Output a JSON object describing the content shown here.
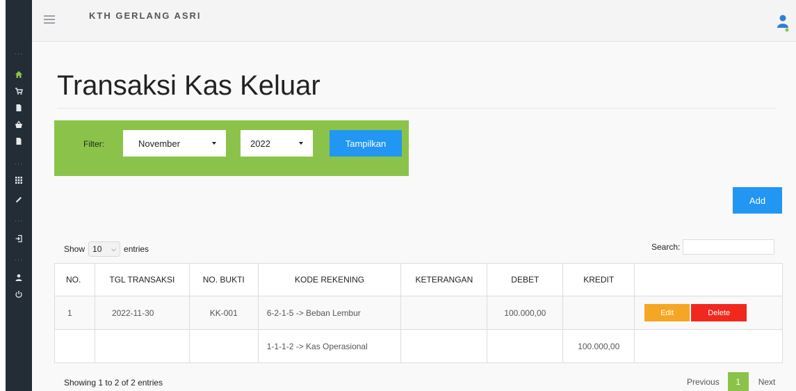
{
  "brand": "KTH GERLANG ASRI",
  "page_title": "Transaksi Kas Keluar",
  "filter": {
    "label": "Filter:",
    "month": "November",
    "year": "2022",
    "submit_label": "Tampilkan"
  },
  "add_label": "Add",
  "table_controls": {
    "show_label": "Show",
    "entries_value": "10",
    "entries_label": "entries",
    "search_label": "Search:"
  },
  "table": {
    "headers": [
      "NO.",
      "TGL TRANSAKSI",
      "NO. BUKTI",
      "KODE REKENING",
      "KETERANGAN",
      "DEBET",
      "KREDIT",
      ""
    ],
    "rows": [
      {
        "no": "1",
        "tgl": "2022-11-30",
        "bukti": "KK-001",
        "kode": "6-2-1-5 -> Beban Lembur",
        "keterangan": "",
        "debet": "100.000,00",
        "kredit": "",
        "edit": "Edit",
        "delete": "Delete"
      },
      {
        "no": "",
        "tgl": "",
        "bukti": "",
        "kode": "1-1-1-2 -> Kas Operasional",
        "keterangan": "",
        "debet": "",
        "kredit": "100.000,00"
      }
    ]
  },
  "footer": {
    "info": "Showing 1 to 2 of 2 entries",
    "prev": "Previous",
    "page": "1",
    "next": "Next"
  },
  "colors": {
    "sidebar": "#232d36",
    "filter_bg": "#8bc34a",
    "primary": "#2196f3",
    "edit": "#f5a623",
    "delete": "#f0281e"
  },
  "icons": {
    "sidebar": [
      "more-dots-icon",
      "home-icon",
      "cart-icon",
      "document-icon",
      "basket-icon",
      "document-icon",
      "more-dots-icon",
      "grid-icon",
      "pencil-icon",
      "more-dots-icon",
      "logout-icon",
      "more-dots-icon",
      "user-icon",
      "power-icon"
    ]
  }
}
